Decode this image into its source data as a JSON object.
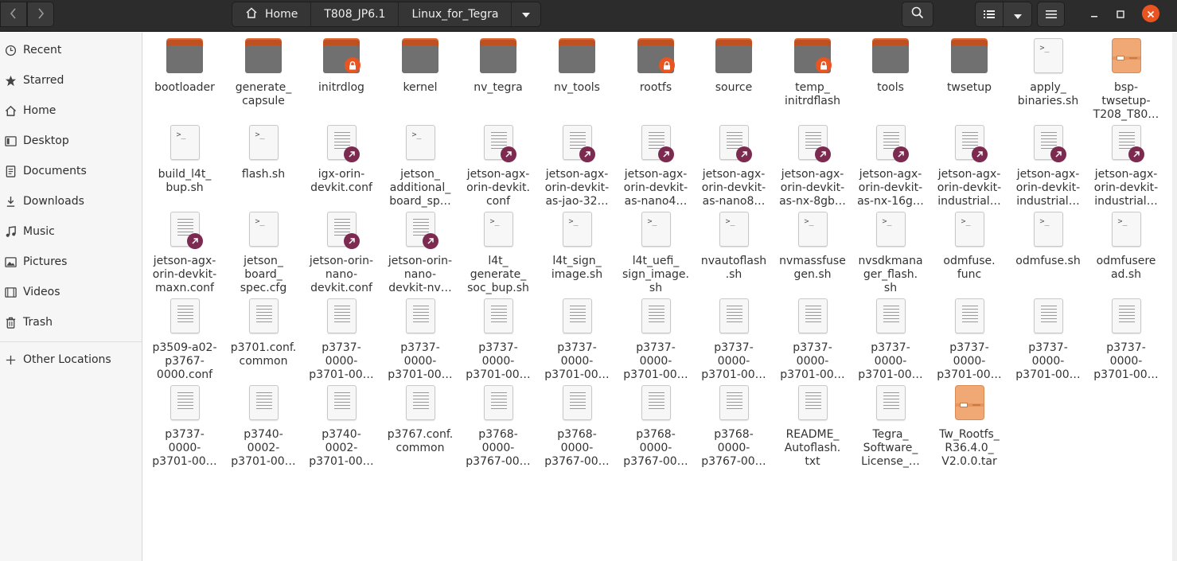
{
  "colors": {
    "headerbar": "#2c2c2c",
    "accent": "#e95420",
    "folder_body": "#707070",
    "folder_tab": "#e06a35",
    "symlink_badge": "#7c2a4f",
    "sidebar_bg": "#f6f6f6"
  },
  "header": {
    "back_icon": "chevron-left-icon",
    "forward_icon": "chevron-right-icon",
    "breadcrumb": [
      "Home",
      "T808_JP6.1",
      "Linux_for_Tegra"
    ],
    "home_icon": "home-icon",
    "search_icon": "search-icon",
    "list_view_icon": "list-view-icon",
    "view_options_icon": "chevron-down-icon",
    "menu_icon": "hamburger-icon",
    "minimize_icon": "minimize-icon",
    "maximize_icon": "maximize-icon",
    "close_icon": "close-icon"
  },
  "sidebar": {
    "items": [
      {
        "label": "Recent",
        "icon": "clock-icon"
      },
      {
        "label": "Starred",
        "icon": "star-icon"
      },
      {
        "label": "Home",
        "icon": "home-icon"
      },
      {
        "label": "Desktop",
        "icon": "desktop-icon"
      },
      {
        "label": "Documents",
        "icon": "document-icon"
      },
      {
        "label": "Downloads",
        "icon": "download-icon"
      },
      {
        "label": "Music",
        "icon": "music-icon"
      },
      {
        "label": "Pictures",
        "icon": "picture-icon"
      },
      {
        "label": "Videos",
        "icon": "video-icon"
      },
      {
        "label": "Trash",
        "icon": "trash-icon"
      }
    ],
    "other_locations": {
      "label": "Other Locations",
      "icon": "plus-icon"
    }
  },
  "files": [
    [
      {
        "name": "bootloader",
        "type": "folder"
      },
      {
        "name": "generate_\ncapsule",
        "type": "folder"
      },
      {
        "name": "initrdlog",
        "type": "folder-locked"
      },
      {
        "name": "kernel",
        "type": "folder"
      },
      {
        "name": "nv_tegra",
        "type": "folder"
      },
      {
        "name": "nv_tools",
        "type": "folder"
      },
      {
        "name": "rootfs",
        "type": "folder-locked"
      },
      {
        "name": "source",
        "type": "folder"
      },
      {
        "name": "temp_\ninitrdflash",
        "type": "folder-locked"
      },
      {
        "name": "tools",
        "type": "folder"
      },
      {
        "name": "twsetup",
        "type": "folder"
      },
      {
        "name": "apply_\nbinaries.sh",
        "type": "script"
      },
      {
        "name": "bsp-\ntwsetup-\nT208_T80…",
        "type": "package"
      }
    ],
    [
      {
        "name": "build_l4t_\nbup.sh",
        "type": "script"
      },
      {
        "name": "flash.sh",
        "type": "script"
      },
      {
        "name": "igx-orin-\ndevkit.conf",
        "type": "text-link"
      },
      {
        "name": "jetson_\nadditional_\nboard_sp…",
        "type": "script"
      },
      {
        "name": "jetson-agx-\norin-devkit.\nconf",
        "type": "text-link"
      },
      {
        "name": "jetson-agx-\norin-devkit-\nas-jao-32…",
        "type": "text-link"
      },
      {
        "name": "jetson-agx-\norin-devkit-\nas-nano4…",
        "type": "text-link"
      },
      {
        "name": "jetson-agx-\norin-devkit-\nas-nano8…",
        "type": "text-link"
      },
      {
        "name": "jetson-agx-\norin-devkit-\nas-nx-8gb…",
        "type": "text-link"
      },
      {
        "name": "jetson-agx-\norin-devkit-\nas-nx-16g…",
        "type": "text-link"
      },
      {
        "name": "jetson-agx-\norin-devkit-\nindustrial…",
        "type": "text-link"
      },
      {
        "name": "jetson-agx-\norin-devkit-\nindustrial…",
        "type": "text-link"
      },
      {
        "name": "jetson-agx-\norin-devkit-\nindustrial…",
        "type": "text-link"
      }
    ],
    [
      {
        "name": "jetson-agx-\norin-devkit-\nmaxn.conf",
        "type": "text-link"
      },
      {
        "name": "jetson_\nboard_\nspec.cfg",
        "type": "script"
      },
      {
        "name": "jetson-orin-\nnano-\ndevkit.conf",
        "type": "text-link"
      },
      {
        "name": "jetson-orin-\nnano-\ndevkit-nv…",
        "type": "text-link"
      },
      {
        "name": "l4t_\ngenerate_\nsoc_bup.sh",
        "type": "script"
      },
      {
        "name": "l4t_sign_\nimage.sh",
        "type": "script"
      },
      {
        "name": "l4t_uefi_\nsign_image.\nsh",
        "type": "script"
      },
      {
        "name": "nvautoflash\n.sh",
        "type": "script"
      },
      {
        "name": "nvmassfuse\ngen.sh",
        "type": "script"
      },
      {
        "name": "nvsdkmana\nger_flash.\nsh",
        "type": "script"
      },
      {
        "name": "odmfuse.\nfunc",
        "type": "script"
      },
      {
        "name": "odmfuse.sh",
        "type": "script"
      },
      {
        "name": "odmfusere\nad.sh",
        "type": "script"
      }
    ],
    [
      {
        "name": "p3509-a02-\np3767-\n0000.conf",
        "type": "text"
      },
      {
        "name": "p3701.conf.\ncommon",
        "type": "text"
      },
      {
        "name": "p3737-\n0000-\np3701-00…",
        "type": "text"
      },
      {
        "name": "p3737-\n0000-\np3701-00…",
        "type": "text"
      },
      {
        "name": "p3737-\n0000-\np3701-00…",
        "type": "text"
      },
      {
        "name": "p3737-\n0000-\np3701-00…",
        "type": "text"
      },
      {
        "name": "p3737-\n0000-\np3701-00…",
        "type": "text"
      },
      {
        "name": "p3737-\n0000-\np3701-00…",
        "type": "text"
      },
      {
        "name": "p3737-\n0000-\np3701-00…",
        "type": "text"
      },
      {
        "name": "p3737-\n0000-\np3701-00…",
        "type": "text"
      },
      {
        "name": "p3737-\n0000-\np3701-00…",
        "type": "text"
      },
      {
        "name": "p3737-\n0000-\np3701-00…",
        "type": "text"
      },
      {
        "name": "p3737-\n0000-\np3701-00…",
        "type": "text"
      }
    ],
    [
      {
        "name": "p3737-\n0000-\np3701-00…",
        "type": "text"
      },
      {
        "name": "p3740-\n0002-\np3701-00…",
        "type": "text"
      },
      {
        "name": "p3740-\n0002-\np3701-00…",
        "type": "text"
      },
      {
        "name": "p3767.conf.\ncommon",
        "type": "text"
      },
      {
        "name": "p3768-\n0000-\np3767-00…",
        "type": "text"
      },
      {
        "name": "p3768-\n0000-\np3767-00…",
        "type": "text"
      },
      {
        "name": "p3768-\n0000-\np3767-00…",
        "type": "text"
      },
      {
        "name": "p3768-\n0000-\np3767-00…",
        "type": "text"
      },
      {
        "name": "README_\nAutoflash.\ntxt",
        "type": "text"
      },
      {
        "name": "Tegra_\nSoftware_\nLicense_…",
        "type": "text"
      },
      {
        "name": "Tw_Rootfs_\nR36.4.0_\nV2.0.0.tar",
        "type": "package"
      }
    ]
  ]
}
